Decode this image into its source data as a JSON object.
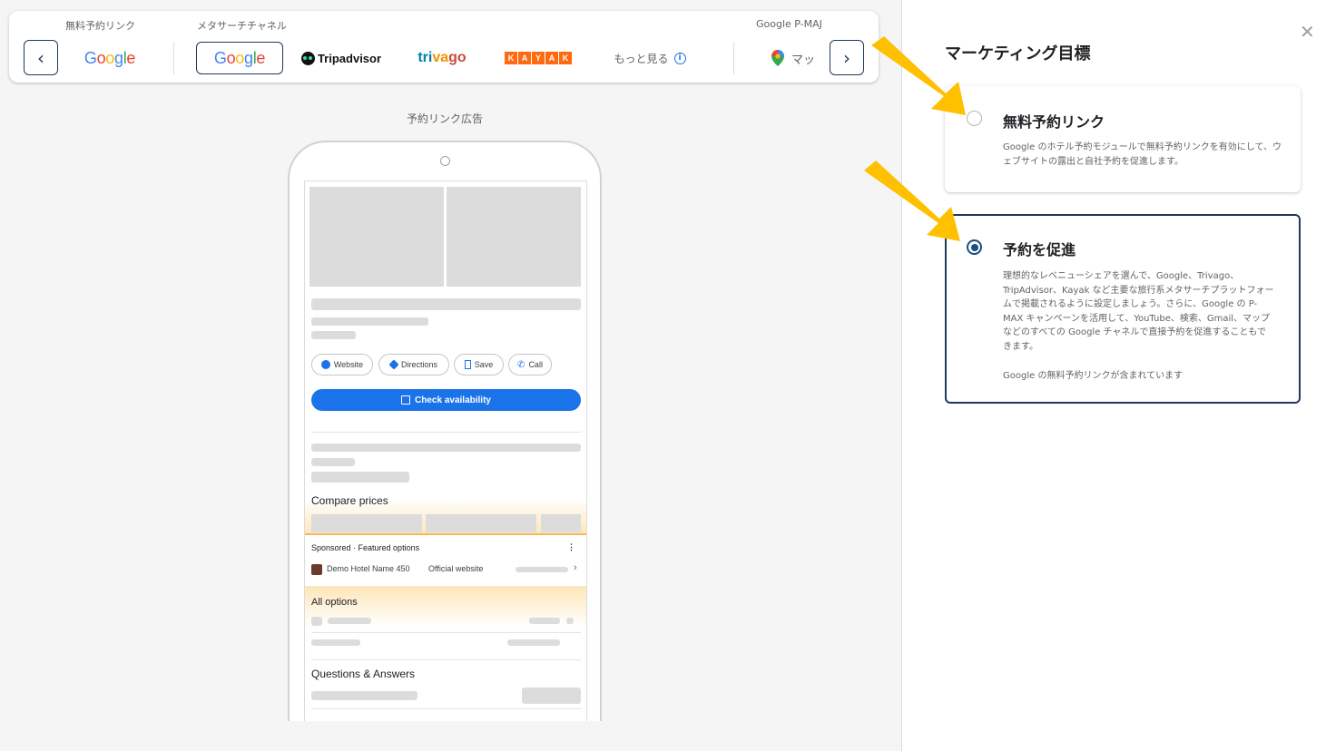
{
  "channel_bar": {
    "groups": {
      "free_booking_links": "無料予約リンク",
      "metasearch": "メタサーチチャネル",
      "pmax": "Google P-MAJ"
    },
    "nav_prev_icon": "chevron-left",
    "nav_next_icon": "chevron-right",
    "channels": {
      "google_free": "Google",
      "google_meta": "Google",
      "tripadvisor": "Tripadvisor",
      "trivago": "trivago",
      "kayak": "KAYAK",
      "more": "もっと見る",
      "maps": "マッ"
    }
  },
  "preview": {
    "title": "予約リンク広告",
    "chips": {
      "website": "Website",
      "directions": "Directions",
      "save": "Save",
      "call": "Call"
    },
    "check_availability": "Check availability",
    "compare_prices": "Compare prices",
    "sponsored": "Sponsored · Featured options",
    "hotel_name": "Demo Hotel Name 450",
    "official_website": "Official website",
    "all_options": "All options",
    "qa": "Questions & Answers"
  },
  "panel": {
    "title": "マーケティング目標",
    "close_icon": "close",
    "options": [
      {
        "title": "無料予約リンク",
        "description": "Google のホテル予約モジュールで無料予約リンクを有効にして、ウェブサイトの露出と自社予約を促進します。",
        "selected": false
      },
      {
        "title": "予約を促進",
        "description": "理想的なレベニューシェアを選んで、Google、Trivago、TripAdvisor、Kayak など主要な旅行系メタサーチプラットフォームで掲載されるように設定しましょう。さらに、Google の P-MAX キャンペーンを活用して、YouTube、検索、Gmail、マップなどのすべての Google チャネルで直接予約を促進することもできます。",
        "note": "Google の無料予約リンクが含まれています",
        "selected": true
      }
    ]
  },
  "colors": {
    "accent_navy": "#1f3a5c",
    "cta_blue": "#1a73e8",
    "arrow_yellow": "#ffc000",
    "kayak_orange": "#ff690f"
  }
}
